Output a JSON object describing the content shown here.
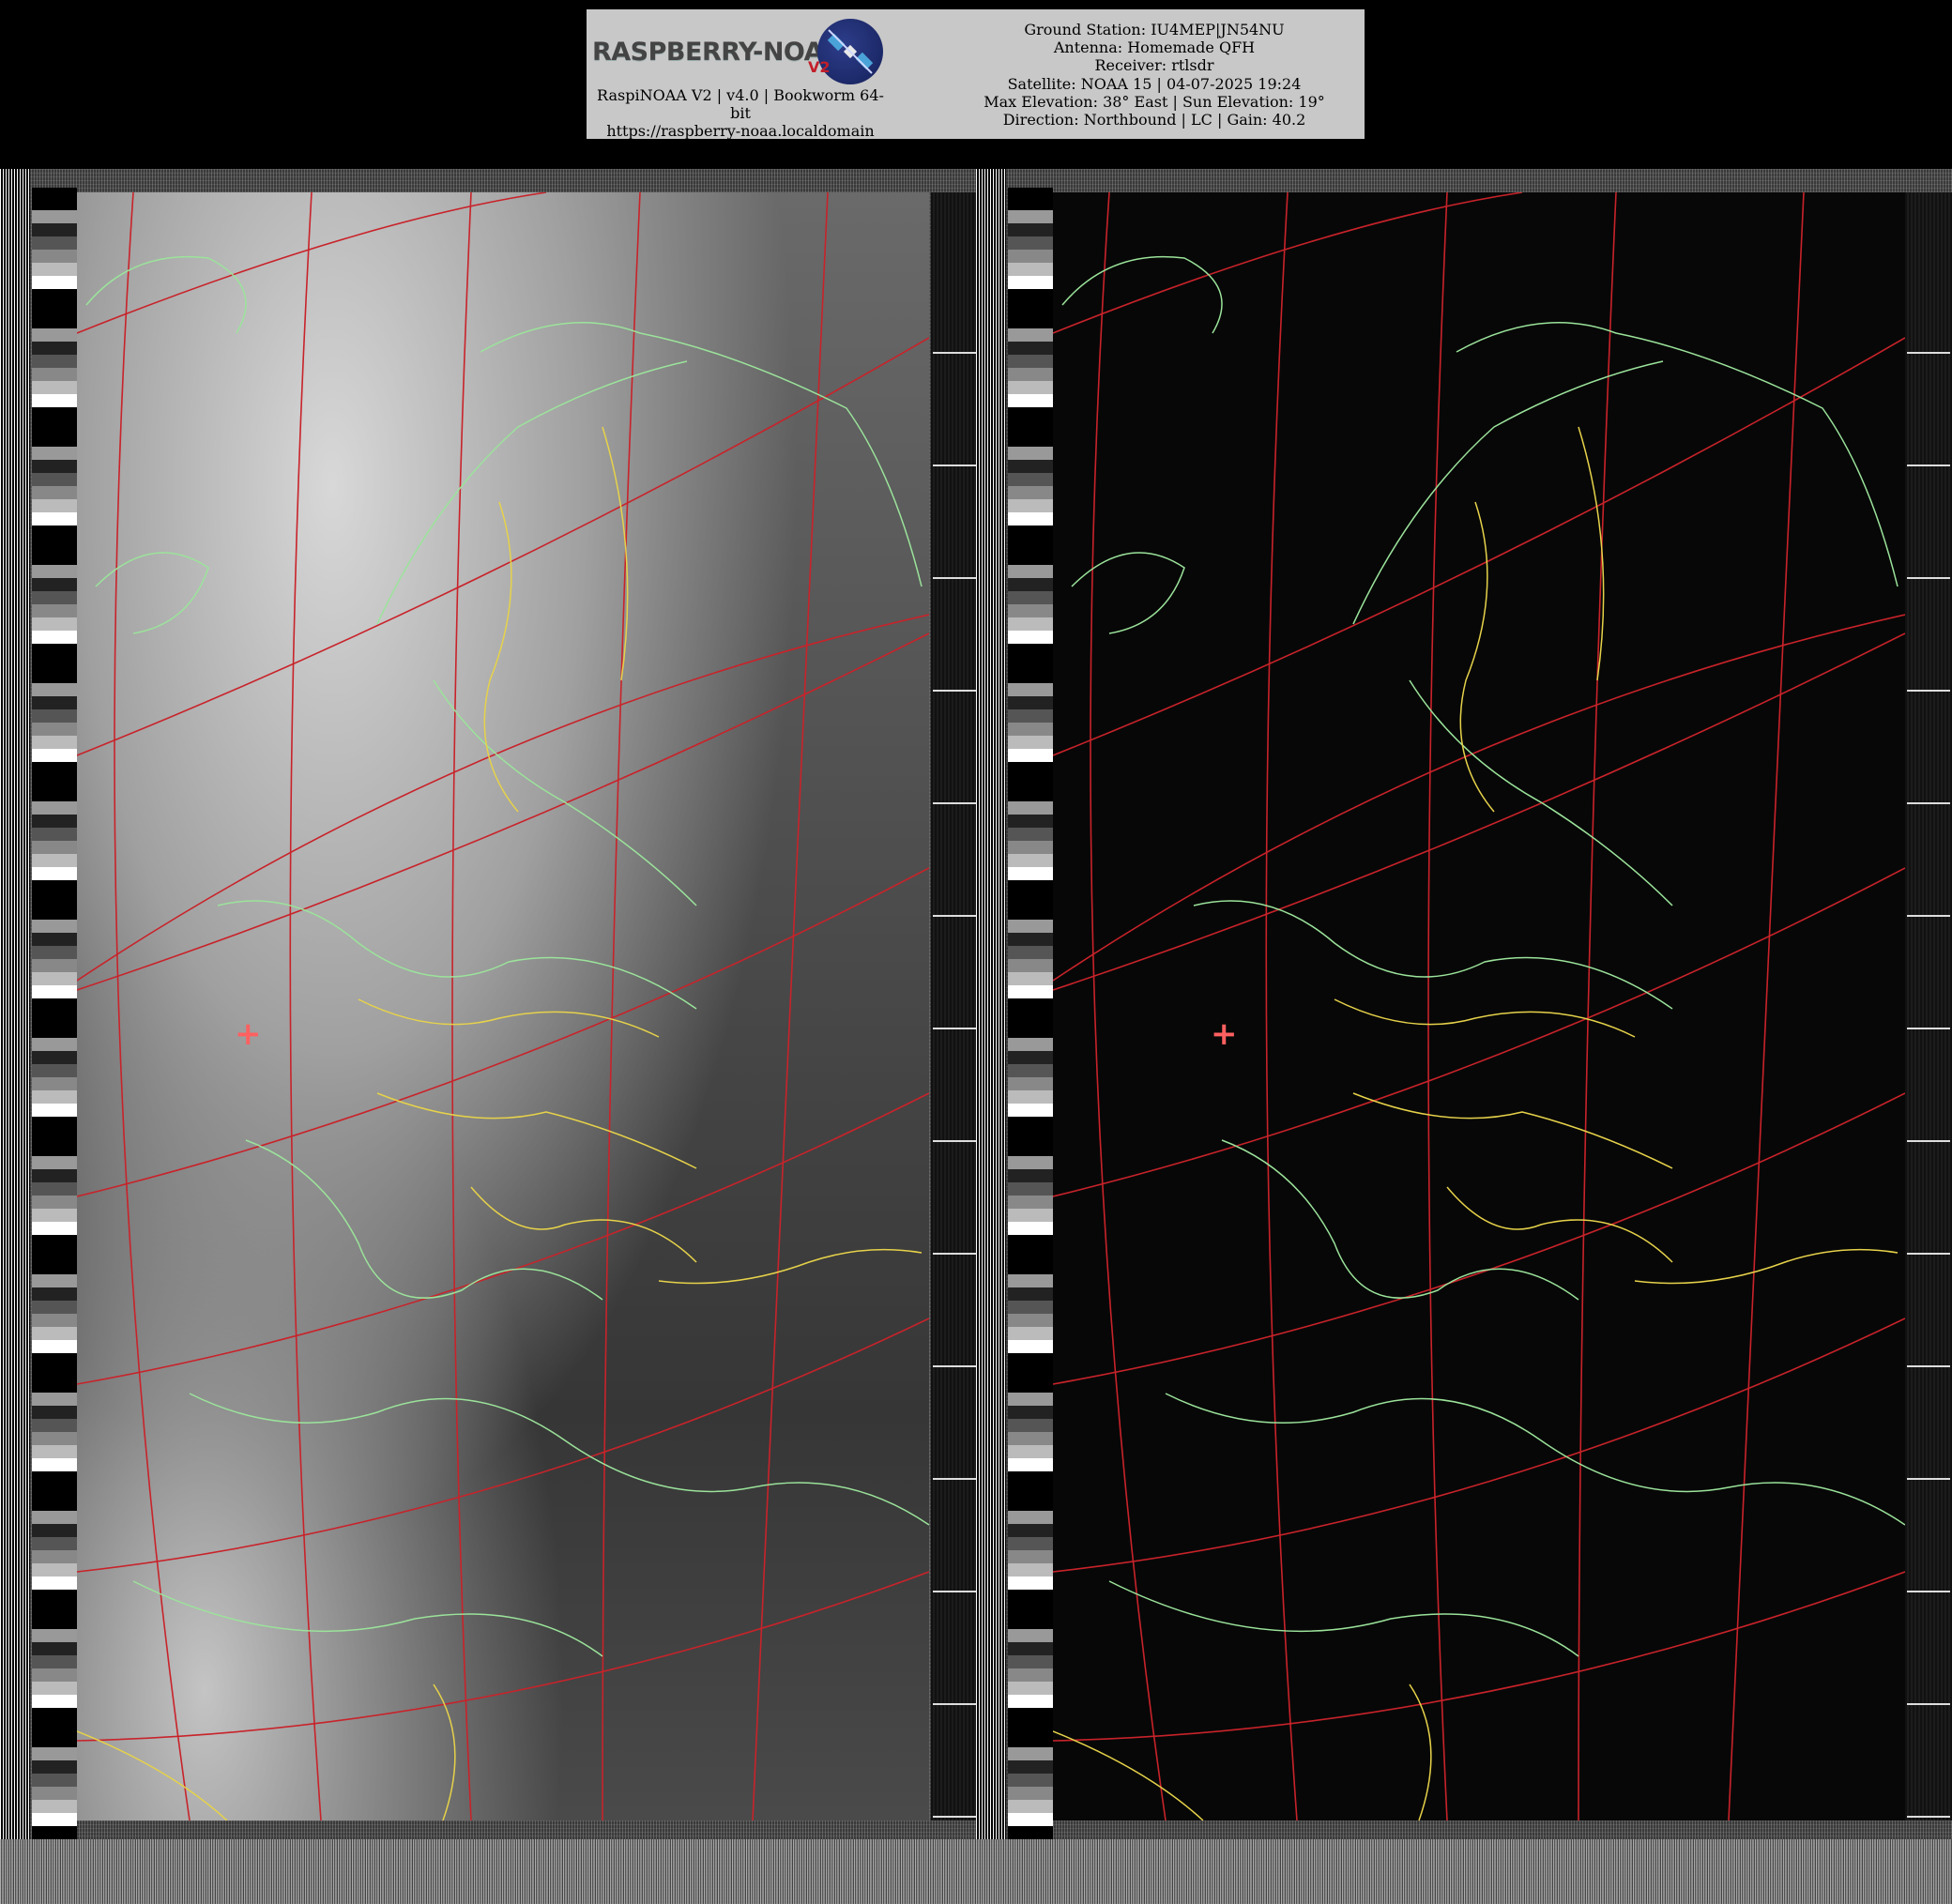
{
  "header": {
    "logo": {
      "wordmark": "RASPBERRY-NOAA",
      "version_badge": "V2",
      "caption_line1": "RaspiNOAA V2 | v4.0 | Bookworm 64-",
      "caption_line2": "bit",
      "url": "https://raspberry-noaa.localdomain"
    },
    "station": {
      "line1": "Ground Station: IU4MEP|JN54NU",
      "line2": "Antenna: Homemade QFH",
      "line3": "Receiver: rtlsdr",
      "line4": "Satellite: NOAA 15 | 04-07-2025 19:24",
      "line5": "Max Elevation: 38° East | Sun Elevation: 19°",
      "line6": "Direction: Northbound | LC | Gain: 40.2"
    }
  },
  "imagery": {
    "channels": [
      "visible",
      "infrared"
    ],
    "overlay_colors": {
      "grid": "#c8232a",
      "coastline": "#9be39b",
      "borders": "#e6d24a",
      "marker": "#ff6060"
    },
    "marker_glyph": "+"
  }
}
